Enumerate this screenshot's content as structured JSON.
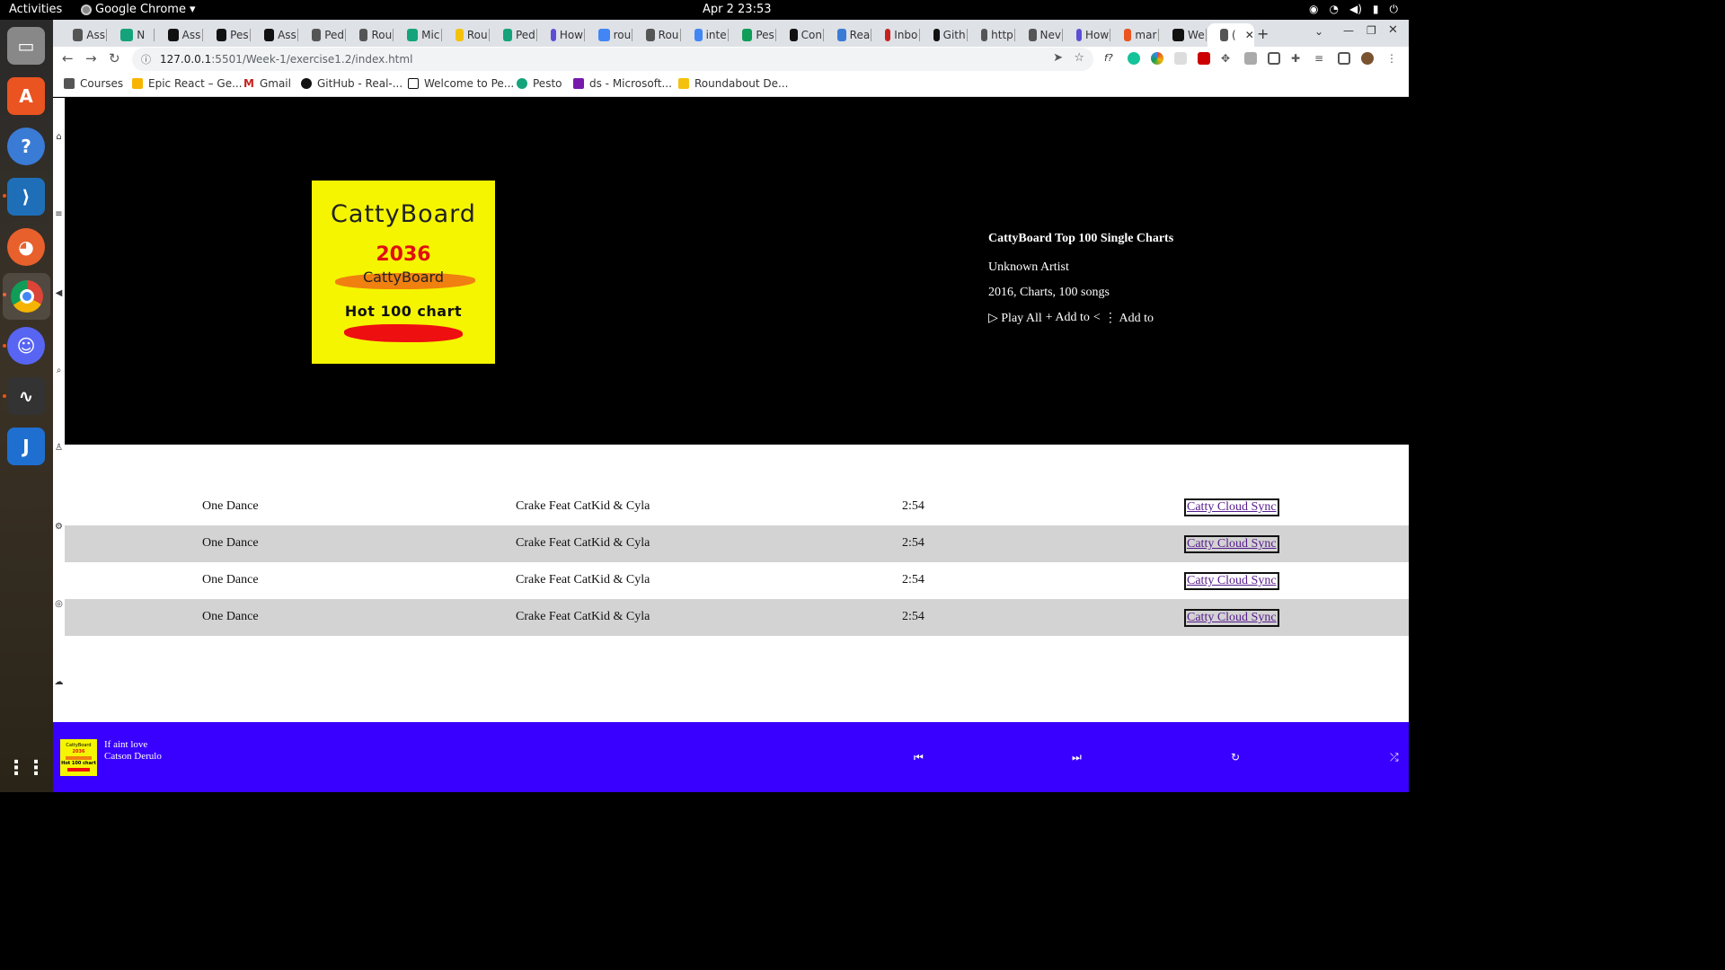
{
  "system": {
    "activities": "Activities",
    "app_name": "Google Chrome",
    "clock": "Apr 2  23:53"
  },
  "browser": {
    "tabs": [
      {
        "label": "Ass"
      },
      {
        "label": "N"
      },
      {
        "label": "Ass"
      },
      {
        "label": "Pes"
      },
      {
        "label": "Ass"
      },
      {
        "label": "Ped"
      },
      {
        "label": "Rou"
      },
      {
        "label": "Mic"
      },
      {
        "label": "Rou"
      },
      {
        "label": "Ped"
      },
      {
        "label": "How"
      },
      {
        "label": "rou"
      },
      {
        "label": "Rou"
      },
      {
        "label": "inte"
      },
      {
        "label": "Pes"
      },
      {
        "label": "Con"
      },
      {
        "label": "Rea"
      },
      {
        "label": "Inbo"
      },
      {
        "label": "Gith"
      },
      {
        "label": "http"
      },
      {
        "label": "Nev"
      },
      {
        "label": "How"
      },
      {
        "label": "mar"
      },
      {
        "label": "We"
      },
      {
        "label": "("
      }
    ],
    "url_host": "127.0.0.1",
    "url_path": ":5501/Week-1/exercise1.2/index.html",
    "bookmarks": [
      {
        "label": "Courses"
      },
      {
        "label": "Epic React – Ge..."
      },
      {
        "label": "Gmail"
      },
      {
        "label": "GitHub - Real-..."
      },
      {
        "label": "Welcome to Pe..."
      },
      {
        "label": "Pesto"
      },
      {
        "label": "ds - Microsoft..."
      },
      {
        "label": "Roundabout De..."
      }
    ]
  },
  "album": {
    "cover": {
      "line1": "CattyBoard",
      "line2": "2036",
      "line3": "CattyBoard",
      "line4": "Hot 100 chart"
    },
    "title": "CattyBoard Top 100 Single Charts",
    "artist": "Unknown Artist",
    "meta": "2016, Charts, 100 songs",
    "actions": {
      "play_all": "▷ Play All",
      "add_to_1": "+ Add to",
      "share": "<",
      "add_to_2": "⋮ Add to"
    }
  },
  "songs": [
    {
      "title": "One Dance",
      "artist": "Crake Feat CatKid & Cyla",
      "duration": "2:54",
      "sync": "Catty Cloud Sync"
    },
    {
      "title": "One Dance",
      "artist": "Crake Feat CatKid & Cyla",
      "duration": "2:54",
      "sync": "Catty Cloud Sync"
    },
    {
      "title": "One Dance",
      "artist": "Crake Feat CatKid & Cyla",
      "duration": "2:54",
      "sync": "Catty Cloud Sync"
    },
    {
      "title": "One Dance",
      "artist": "Crake Feat CatKid & Cyla",
      "duration": "2:54",
      "sync": "Catty Cloud Sync"
    }
  ],
  "player": {
    "now_title": "If aint love",
    "now_artist": "Catson Derulo",
    "mini_cover": {
      "line1": "CattyBoard",
      "line2": "2036",
      "line3": "Hot 100 chart"
    }
  },
  "colors": {
    "hero_bg": "#000000",
    "cover_bg": "#f5f500",
    "player_bg": "#3a00ff",
    "row_alt": "#d3d3d3"
  }
}
